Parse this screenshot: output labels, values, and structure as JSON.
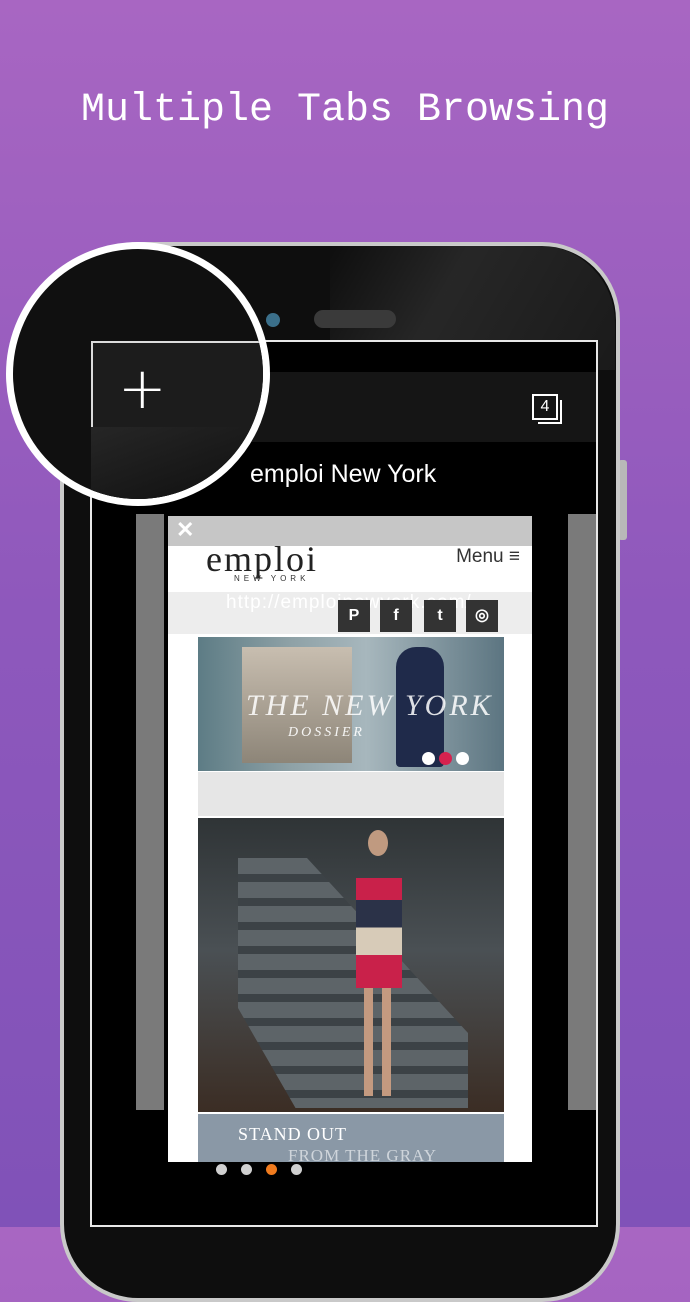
{
  "headline": "Multiple Tabs Browsing",
  "browser": {
    "tab_count": "4",
    "tab_title": "emploi New York",
    "new_tab_symbol": "+",
    "close_symbol": "✕",
    "url": "http://emploinewyork.com/"
  },
  "site": {
    "logo": "emploi",
    "logo_sub": "NEW YORK",
    "menu_label": "Menu ≡",
    "social_icons": [
      "pinterest-icon",
      "facebook-icon",
      "twitter-icon",
      "instagram-icon"
    ],
    "hero_title": "THE NEW YORK",
    "hero_subtitle": "DOSSIER",
    "banner_line1": "STAND OUT",
    "banner_line2": "FROM THE GRAY"
  },
  "carousel": {
    "active_index": 1,
    "count": 3
  },
  "pager": {
    "count": 4,
    "active_index": 2,
    "active_color": "#f07b1e"
  },
  "colors": {
    "background_top": "#a866c2",
    "background_bottom": "#8052b8",
    "accent_red": "#d6224f"
  }
}
